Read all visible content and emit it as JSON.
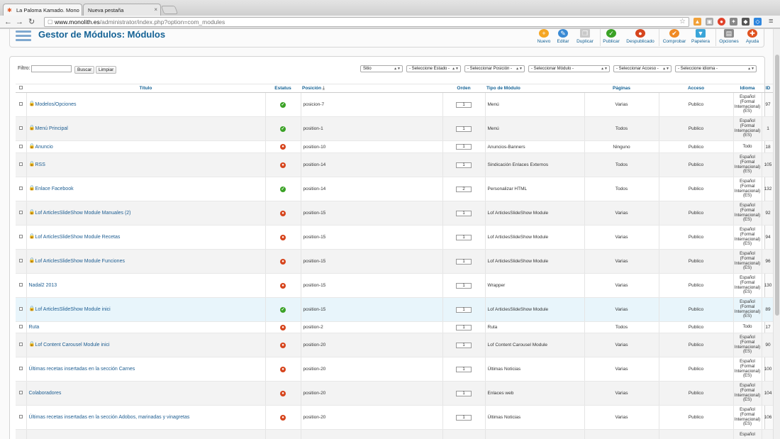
{
  "browser": {
    "tabs": [
      {
        "label": "La Paloma Kamado. Mono"
      },
      {
        "label": "Nueva pestaña"
      }
    ],
    "url_host": "www.monolith.es",
    "url_path": "/administrator/index.php?option=com_modules"
  },
  "header": {
    "title": "Gestor de Módulos: Módulos",
    "buttons": [
      {
        "label": "Nuevo",
        "icon": "plus-circle-icon",
        "color": "#f5a623"
      },
      {
        "label": "Editar",
        "icon": "pencil-icon",
        "color": "#3a8ad4"
      },
      {
        "label": "Duplicar",
        "icon": "copy-icon",
        "color": "#9a9a9a"
      },
      {
        "label": "Publicar",
        "icon": "check-icon",
        "color": "#3ba226"
      },
      {
        "label": "Despublicado",
        "icon": "unpublish-icon",
        "color": "#d6451d"
      },
      {
        "label": "Comprobar",
        "icon": "checkin-icon",
        "color": "#f08a24"
      },
      {
        "label": "Papelera",
        "icon": "trash-icon",
        "color": "#3aa5d8"
      },
      {
        "label": "Opciones",
        "icon": "options-icon",
        "color": "#8a8a8a"
      },
      {
        "label": "Ayuda",
        "icon": "help-icon",
        "color": "#e0521f"
      }
    ]
  },
  "filters": {
    "label": "Filtro:",
    "search_value": "",
    "search_button": "Buscar",
    "clear_button": "Limpiar",
    "selects": [
      "Sitio",
      "- Seleccione Estado -",
      "- Seleccionar Posición -",
      "- Seleccionar Módulo -",
      "- Seleccionar Acceso -",
      "- Seleccione idioma -"
    ]
  },
  "table": {
    "headers": {
      "title": "Título",
      "status": "Estatus",
      "position": "Posición",
      "order": "Orden",
      "type": "Tipo de Módulo",
      "pages": "Páginas",
      "access": "Acceso",
      "language": "Idioma",
      "id": "ID"
    },
    "rows": [
      {
        "title": "Modelos/Opciones",
        "locked": true,
        "status": "on",
        "position": "posicion-7",
        "order": "1",
        "type": "Menú",
        "pages": "Varias",
        "access": "Publico",
        "language": [
          "Español",
          "(Formal",
          "Internacional)",
          "(ES)"
        ],
        "id": "97"
      },
      {
        "title": "Menú Principal",
        "locked": true,
        "status": "on",
        "position": "position-1",
        "order": "1",
        "type": "Menú",
        "pages": "Todos",
        "access": "Publico",
        "language": [
          "Español",
          "(Formal",
          "Internacional)",
          "(ES)"
        ],
        "id": "1"
      },
      {
        "title": "Anuncio",
        "locked": true,
        "status": "off",
        "position": "position-10",
        "order": "1",
        "type": "Anuncios-Banners",
        "pages": "Ninguno",
        "access": "Publico",
        "language": [
          "Todo"
        ],
        "id": "18"
      },
      {
        "title": "RSS",
        "locked": true,
        "status": "off",
        "position": "position-14",
        "order": "1",
        "type": "Sindicación Enlaces Externos",
        "pages": "Todos",
        "access": "Publico",
        "language": [
          "Español",
          "(Formal",
          "Internacional)",
          "(ES)"
        ],
        "id": "105"
      },
      {
        "title": "Enlace Facebook",
        "locked": true,
        "status": "on",
        "position": "position-14",
        "order": "2",
        "type": "Personalizar HTML",
        "pages": "Todos",
        "access": "Publico",
        "language": [
          "Español",
          "(Formal",
          "Internacional)",
          "(ES)"
        ],
        "id": "132"
      },
      {
        "title": "Lof ArticlesSlideShow Module Manuales (2)",
        "locked": true,
        "status": "off",
        "position": "position-15",
        "order": "1",
        "type": "Lof ArticlesSlideShow Module",
        "pages": "Varias",
        "access": "Publico",
        "language": [
          "Español",
          "(Formal",
          "Internacional)",
          "(ES)"
        ],
        "id": "92"
      },
      {
        "title": "Lof ArticlesSlideShow Module Recetas",
        "locked": true,
        "status": "off",
        "position": "position-15",
        "order": "1",
        "type": "Lof ArticlesSlideShow Module",
        "pages": "Varias",
        "access": "Publico",
        "language": [
          "Español",
          "(Formal",
          "Internacional)",
          "(ES)"
        ],
        "id": "94"
      },
      {
        "title": "Lof ArticlesSlideShow Module Funciones",
        "locked": true,
        "status": "off",
        "position": "position-15",
        "order": "1",
        "type": "Lof ArticlesSlideShow Module",
        "pages": "Varias",
        "access": "Publico",
        "language": [
          "Español",
          "(Formal",
          "Internacional)",
          "(ES)"
        ],
        "id": "96"
      },
      {
        "title": "Nadal2 2013",
        "locked": false,
        "status": "off",
        "position": "position-15",
        "order": "1",
        "type": "Wrapper",
        "pages": "Varias",
        "access": "Publico",
        "language": [
          "Español",
          "(Formal",
          "Internacional)",
          "(ES)"
        ],
        "id": "130"
      },
      {
        "title": "Lof ArticlesSlideShow Module inici",
        "locked": true,
        "status": "on",
        "position": "position-15",
        "order": "1",
        "type": "Lof ArticlesSlideShow Module",
        "pages": "Varias",
        "access": "Publico",
        "language": [
          "Español",
          "(Formal",
          "Internacional)",
          "(ES)"
        ],
        "id": "89"
      },
      {
        "title": "Ruta",
        "locked": false,
        "status": "off",
        "position": "position-2",
        "order": "1",
        "type": "Ruta",
        "pages": "Todos",
        "access": "Publico",
        "language": [
          "Todo"
        ],
        "id": "17"
      },
      {
        "title": "Lof Content Carousel Module inici",
        "locked": true,
        "status": "off",
        "position": "position-20",
        "order": "1",
        "type": "Lof Content Carousel Module",
        "pages": "Varias",
        "access": "Publico",
        "language": [
          "Español",
          "(Formal",
          "Internacional)",
          "(ES)"
        ],
        "id": "90"
      },
      {
        "title": "Últimas recetas insertadas en la sección Carnes",
        "locked": false,
        "status": "off",
        "position": "position-20",
        "order": "1",
        "type": "Últimas Noticias",
        "pages": "Varias",
        "access": "Publico",
        "language": [
          "Español",
          "(Formal",
          "Internacional)",
          "(ES)"
        ],
        "id": "100"
      },
      {
        "title": "Colaboradores",
        "locked": false,
        "status": "off",
        "position": "position-20",
        "order": "1",
        "type": "Enlaces web",
        "pages": "Varias",
        "access": "Publico",
        "language": [
          "Español",
          "(Formal",
          "Internacional)",
          "(ES)"
        ],
        "id": "104"
      },
      {
        "title": "Últimas recetas insertadas en la sección Adobos, marinadas y vinagretas",
        "locked": false,
        "status": "off",
        "position": "position-20",
        "order": "1",
        "type": "Últimas Noticias",
        "pages": "Varias",
        "access": "Publico",
        "language": [
          "Español",
          "(Formal",
          "Internacional)",
          "(ES)"
        ],
        "id": "106"
      },
      {
        "title": "",
        "locked": false,
        "status": "",
        "position": "",
        "order": "",
        "type": "",
        "pages": "",
        "access": "",
        "language": [
          "Español"
        ],
        "id": ""
      }
    ]
  }
}
